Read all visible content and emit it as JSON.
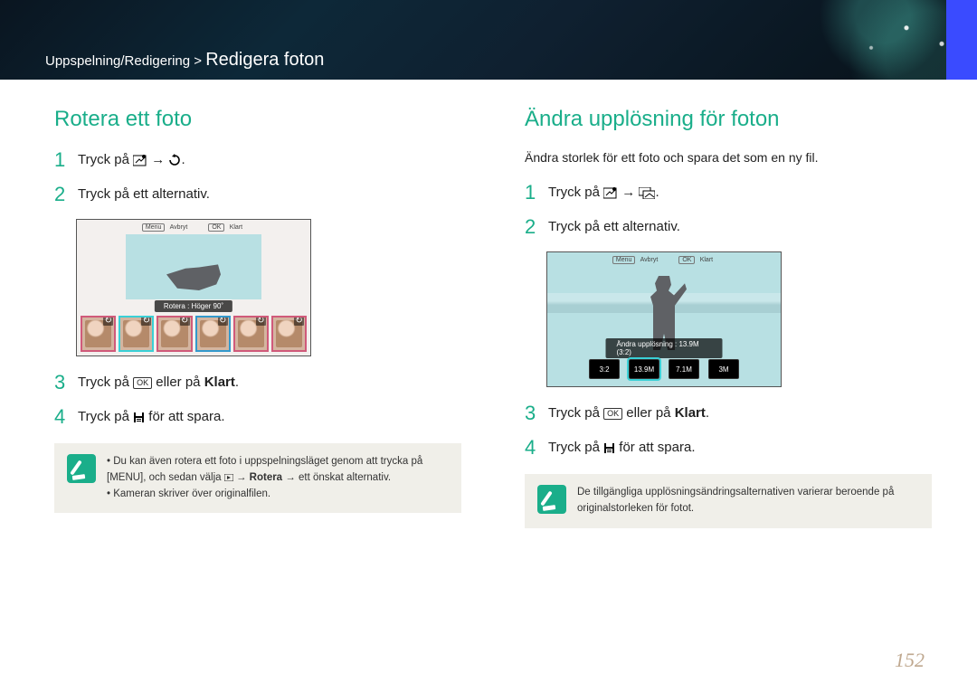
{
  "header": {
    "breadcrumb_prefix": "Uppspelning/Redigering > ",
    "page_title": "Redigera foton"
  },
  "page_number": "152",
  "left": {
    "heading": "Rotera ett foto",
    "step1": "Tryck på ",
    "step1_tail": ".",
    "step2": "Tryck på ett alternativ.",
    "step3_a": "Tryck på ",
    "step3_b": " eller på ",
    "step3_bold": "Klart",
    "step3_c": ".",
    "step4_a": "Tryck på ",
    "step4_b": " för att spara.",
    "shot": {
      "top_cancel": "Avbryt",
      "top_done": "Klart",
      "label": "Rotera : Höger 90˚",
      "menu_btn": "Menu",
      "ok_btn": "OK"
    },
    "note_line1_a": "Du kan även rotera ett foto i uppspelningsläget genom att trycka på ",
    "note_line1_menu": "[MENU]",
    "note_line1_b": ", och sedan välja ",
    "note_line1_seq": " → Rotera → ",
    "note_line1_c": "ett önskat alternativ.",
    "note_line2": "Kameran skriver över originalfilen."
  },
  "right": {
    "heading": "Ändra upplösning för foton",
    "intro": "Ändra storlek för ett foto och spara det som en ny fil.",
    "step1": "Tryck på ",
    "step1_tail": ".",
    "step2": "Tryck på ett alternativ.",
    "step3_a": "Tryck på ",
    "step3_b": " eller på ",
    "step3_bold": "Klart",
    "step3_c": ".",
    "step4_a": "Tryck på ",
    "step4_b": " för att spara.",
    "shot": {
      "top_cancel": "Avbryt",
      "top_done": "Klart",
      "label": "Ändra upplösning : 13.9M (3:2)",
      "menu_btn": "Menu",
      "ok_btn": "OK",
      "options": [
        "3:2",
        "13.9M",
        "7.1M",
        "3M"
      ]
    },
    "note": "De tillgängliga upplösningsändringsalternativen varierar beroende på originalstorleken för fotot."
  }
}
